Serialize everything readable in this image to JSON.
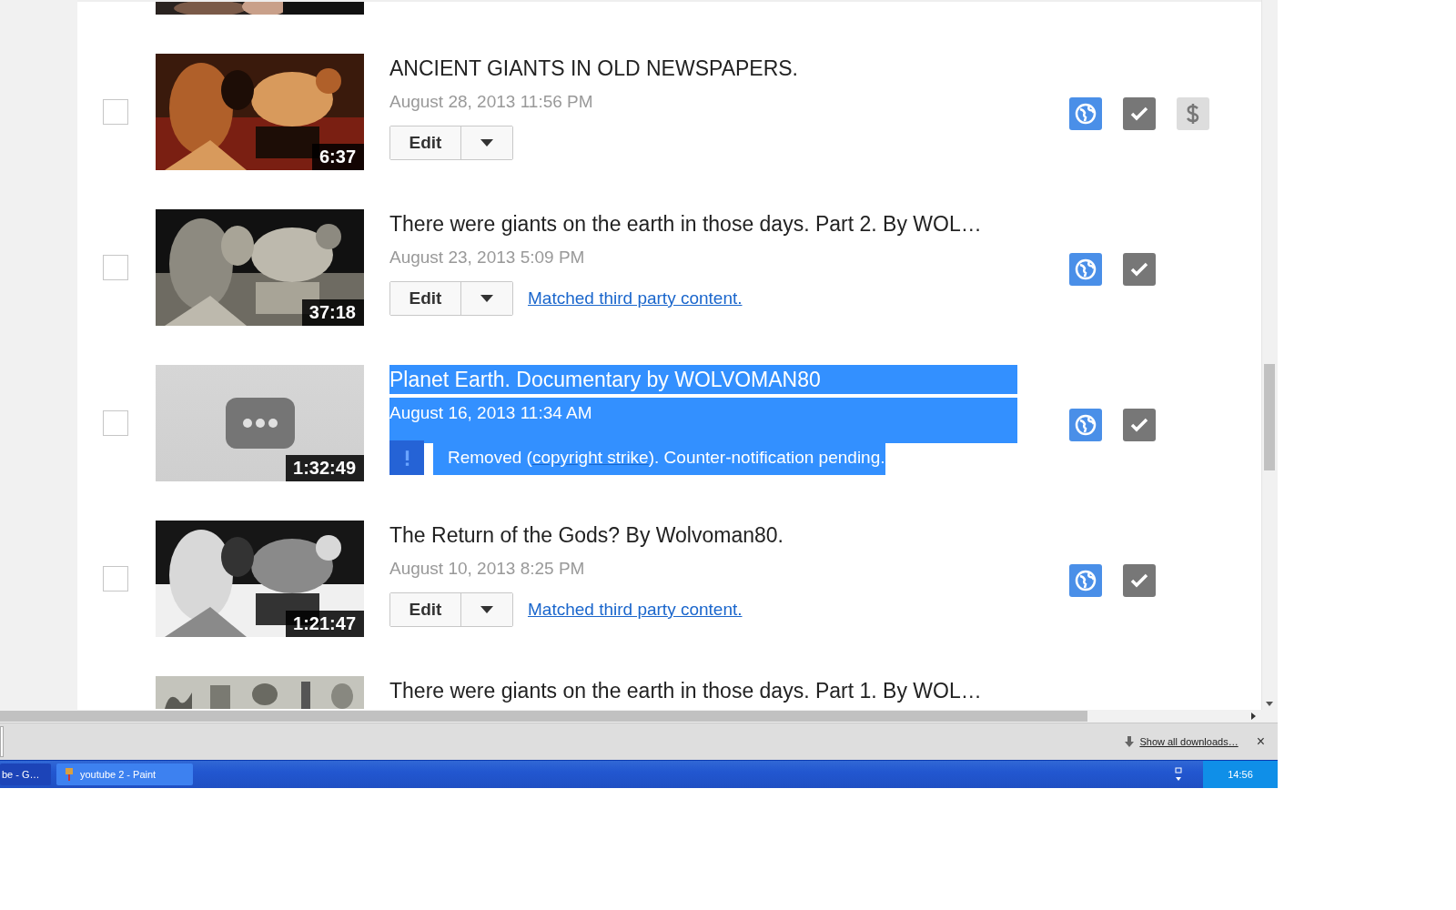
{
  "videos": [
    {
      "title": "ANCIENT GIANTS IN OLD NEWSPAPERS.",
      "date": "August 28, 2013 11:56 PM",
      "duration": "6:37",
      "thumbnail": {
        "kind": "picture"
      },
      "checked": false,
      "highlighted": false,
      "edit": {
        "label": "Edit"
      },
      "badges": [
        {
          "kind": "public"
        },
        {
          "kind": "published"
        },
        {
          "kind": "monetized"
        }
      ]
    },
    {
      "title": "There were giants on the earth in those days. Part 2. By WOL…",
      "date": "August 23, 2013 5:09 PM",
      "duration": "37:18",
      "thumbnail": {
        "kind": "picture"
      },
      "checked": false,
      "highlighted": false,
      "edit": {
        "label": "Edit"
      },
      "link": "Matched third party content.",
      "badges": [
        {
          "kind": "public"
        },
        {
          "kind": "published"
        }
      ]
    },
    {
      "title": "Planet Earth. Documentary by WOLVOMAN80",
      "date": "August 16, 2013 11:34 AM",
      "duration": "1:32:49",
      "thumbnail": {
        "kind": "placeholder"
      },
      "checked": false,
      "highlighted": true,
      "notice": {
        "before": "Removed (",
        "link": "copyright strike",
        "after": "). Counter-notification pending."
      },
      "badges": [
        {
          "kind": "public"
        },
        {
          "kind": "published"
        }
      ]
    },
    {
      "title": "The Return of the Gods? By Wolvoman80.",
      "date": "August 10, 2013 8:25 PM",
      "duration": "1:21:47",
      "thumbnail": {
        "kind": "picture"
      },
      "checked": false,
      "highlighted": false,
      "edit": {
        "label": "Edit"
      },
      "link": "Matched third party content.",
      "badges": [
        {
          "kind": "public"
        },
        {
          "kind": "published"
        }
      ]
    }
  ],
  "last_video": {
    "title": "There were giants on the earth in those days. Part 1. By WOL…"
  },
  "downloads_bar": {
    "link": "Show all downloads…",
    "close": "×"
  },
  "taskbar": {
    "items": [
      {
        "label": "be - G…",
        "selected": false
      },
      {
        "label": "youtube 2 - Paint",
        "selected": true
      }
    ],
    "clock": "14:56"
  }
}
